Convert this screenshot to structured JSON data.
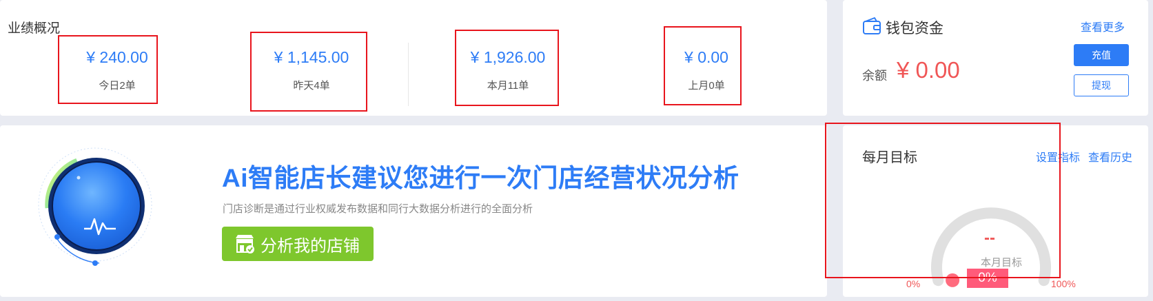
{
  "performance": {
    "title": "业绩概况",
    "stats": [
      {
        "amount": "¥ 240.00",
        "label": "今日2单"
      },
      {
        "amount": "¥ 1,145.00",
        "label": "昨天4单"
      },
      {
        "amount": "¥ 1,926.00",
        "label": "本月11单"
      },
      {
        "amount": "¥ 0.00",
        "label": "上月0单"
      }
    ]
  },
  "wallet": {
    "title": "钱包资金",
    "more_link": "查看更多",
    "balance_label": "余额",
    "balance_value": "¥ 0.00",
    "recharge_button": "充值",
    "withdraw_button": "提现"
  },
  "ai": {
    "headline": "Ai智能店长建议您进行一次门店经营状况分析",
    "description": "门店诊断是通过行业权威发布数据和同行大数据分析进行的全面分析",
    "analyze_button": "分析我的店铺"
  },
  "monthly_target": {
    "title": "每月目标",
    "set_link": "设置指标",
    "history_link": "查看历史",
    "value": "--",
    "gauge_label": "本月目标",
    "progress_text": "0%",
    "progress_value": 0,
    "min_label": "0%",
    "max_label": "100%"
  },
  "colors": {
    "accent": "#2d7cf6",
    "negative": "#f05656",
    "success": "#7ec72d",
    "highlight_box": "#e8141c"
  },
  "icons": [
    "wallet-icon",
    "store-icon",
    "ai-orb-icon"
  ]
}
